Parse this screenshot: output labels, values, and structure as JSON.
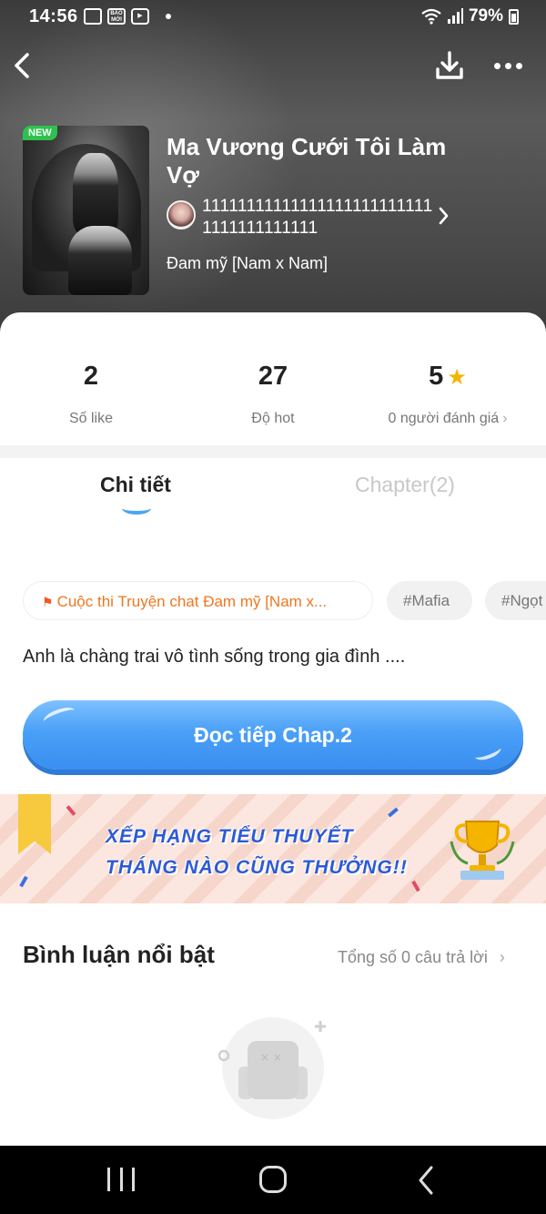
{
  "status_bar": {
    "time": "14:56",
    "battery": "79%",
    "icons": [
      "screen-mirror-icon",
      "bao-moi-icon",
      "media-icon",
      "notification-dot",
      "wifi-icon",
      "signal-icon",
      "battery-icon"
    ],
    "bao_moi_label": "BÁO MỚI"
  },
  "header": {
    "new_badge": "NEW",
    "title": "Ma Vương Cưới Tôi Làm Vợ",
    "author": "111111111111111111111111111111111111111",
    "genre": "Đam mỹ [Nam x Nam]"
  },
  "stats": [
    {
      "value": "2",
      "label": "Số like"
    },
    {
      "value": "27",
      "label": "Độ hot"
    },
    {
      "value": "5",
      "label": "0 người đánh giá"
    }
  ],
  "tabs": {
    "detail": "Chi tiết",
    "chapter": "Chapter(2)"
  },
  "tags": {
    "contest": "Cuộc thi Truyện chat Đam mỹ [Nam x...",
    "mafia": "#Mafia",
    "ngot": "#Ngọt"
  },
  "summary": "Anh là chàng trai vô tình sống trong gia đình ....",
  "read_button": "Đọc tiếp Chap.2",
  "banner": {
    "line1": "XẾP HẠNG TIỂU THUYẾT",
    "line2": "THÁNG NÀO CŨNG THƯỞNG!!"
  },
  "comments": {
    "title": "Bình luận nổi bật",
    "count": "Tổng số 0 câu trả lời"
  },
  "colors": {
    "accent_blue": "#4aa0f7",
    "tag_orange": "#ee7722",
    "new_green": "#2fc14f",
    "star_yellow": "#f4b400",
    "banner_text_blue": "#2d5ad6"
  }
}
